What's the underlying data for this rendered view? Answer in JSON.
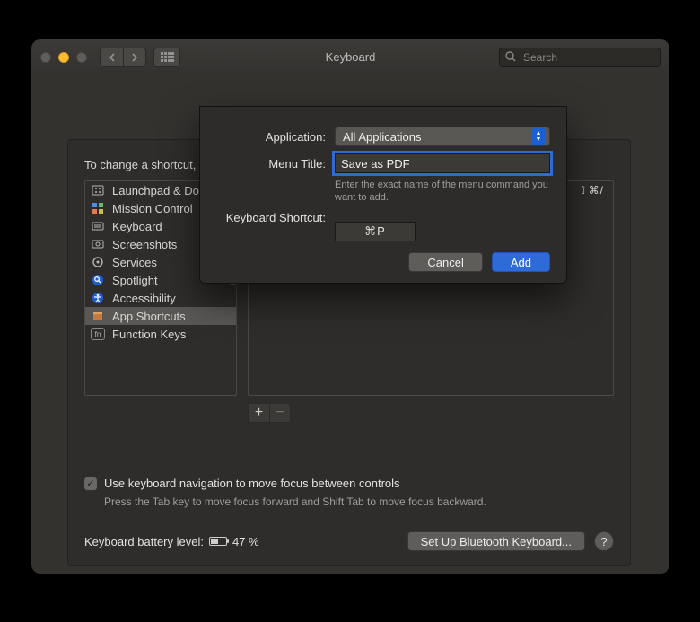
{
  "window": {
    "title": "Keyboard",
    "search_placeholder": "Search"
  },
  "hint": "To change a shortcut, select it, click the key combination, and then type the new keys.",
  "categories": [
    {
      "label": "Launchpad & Dock"
    },
    {
      "label": "Mission Control"
    },
    {
      "label": "Keyboard"
    },
    {
      "label": "Screenshots"
    },
    {
      "label": "Services"
    },
    {
      "label": "Spotlight"
    },
    {
      "label": "Accessibility"
    },
    {
      "label": "App Shortcuts"
    },
    {
      "label": "Function Keys"
    }
  ],
  "shortcut_display": "⇧⌘/",
  "checkbox": {
    "label": "Use keyboard navigation to move focus between controls",
    "help": "Press the Tab key to move focus forward and Shift Tab to move focus backward."
  },
  "battery": {
    "label": "Keyboard battery level:",
    "percent": "47 %"
  },
  "bluetooth_button": "Set Up Bluetooth Keyboard...",
  "sheet": {
    "application_label": "Application:",
    "application_value": "All Applications",
    "menu_title_label": "Menu Title:",
    "menu_title_value": "Save as PDF",
    "menu_title_help": "Enter the exact name of the menu command you want to add.",
    "shortcut_label": "Keyboard Shortcut:",
    "shortcut_value": "⌘P",
    "cancel": "Cancel",
    "add": "Add"
  }
}
